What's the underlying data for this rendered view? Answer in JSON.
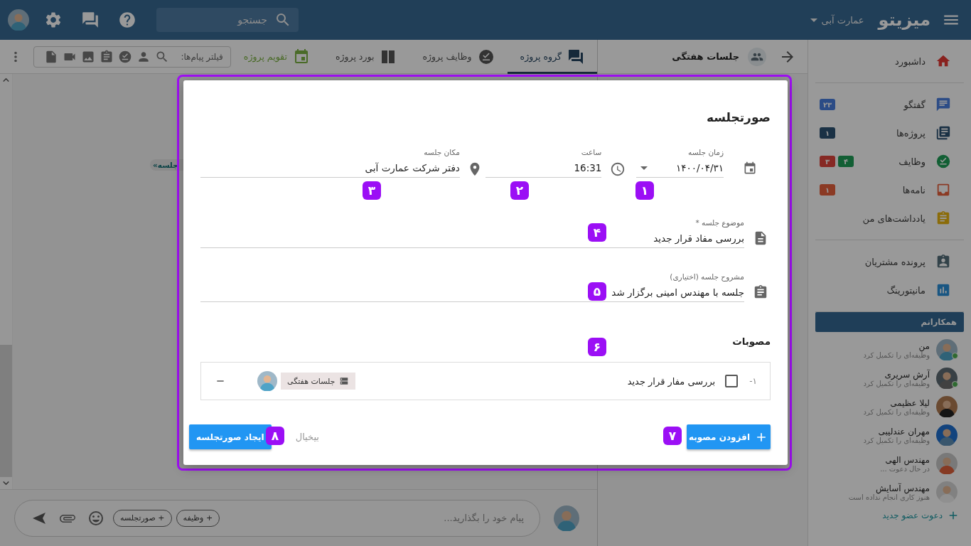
{
  "topbar": {
    "logo": "میزیتو",
    "workspace": "عمارت آبی",
    "search": {
      "placeholder": "جستجو"
    }
  },
  "sidebar": {
    "sections": [
      {
        "items": [
          {
            "label": "داشبورد",
            "color": "#89221f"
          }
        ]
      },
      {
        "items": [
          {
            "label": "گفتگو",
            "color": "#2c4c86",
            "badges": [
              {
                "text": "۲۳",
                "color": "#2c4c86"
              }
            ]
          },
          {
            "label": "پروژه‌ها",
            "color": "#1a3145",
            "badges": [
              {
                "text": "۱",
                "color": "#1a3145"
              }
            ]
          },
          {
            "label": "وظایف",
            "color": "#125f34",
            "badges": [
              {
                "text": "۴",
                "color": "#125f34"
              },
              {
                "text": "۳",
                "color": "#862924"
              }
            ]
          },
          {
            "label": "نامه‌ها",
            "color": "#8b3a24",
            "badges": [
              {
                "text": "۱",
                "color": "#8b3a24"
              }
            ]
          },
          {
            "label": "یادداشت‌های من",
            "color": "#8b6c09"
          }
        ]
      },
      {
        "items": [
          {
            "label": "پرونده مشتریان",
            "color": "#324249"
          },
          {
            "label": "مانیتورینگ",
            "color": "#195682"
          }
        ]
      }
    ],
    "colleagues": {
      "title": "همکارانم",
      "members": [
        {
          "name": "من",
          "status": "وظیفه‌ای را تکمیل کرد",
          "online": true
        },
        {
          "name": "آرش سریری",
          "status": "وظیفه‌ای را تکمیل کرد",
          "online": true
        },
        {
          "name": "لیلا عظیمی",
          "status": "وظیفه‌ای را تکمیل کرد",
          "online": false
        },
        {
          "name": "مهران عندلیبی",
          "status": "وظیفه‌ای را تکمیل کرد",
          "online": false
        },
        {
          "name": "مهندس الهی",
          "status": "در حال دعوت ...",
          "online": false
        },
        {
          "name": "مهندس آسایش",
          "status": "هنوز کاری انجام نداده است",
          "online": false
        }
      ],
      "invite": "دعوت عضو جدید"
    }
  },
  "channel_panel": {
    "title": "جلسات هفتگی"
  },
  "chat": {
    "tabs": [
      {
        "label": "گروه پروژه",
        "selected": true,
        "color": "#16293a"
      },
      {
        "label": "وظایف پروژه",
        "selected": false,
        "color": "#333333"
      },
      {
        "label": "بورد پروژه",
        "selected": false,
        "color": "#333333"
      },
      {
        "label": "تقویم پروژه",
        "selected": false,
        "color": "#4a6b28"
      }
    ],
    "filter_label": "فیلتر پیام‌ها:",
    "message_chip": "جلسه»",
    "composer": {
      "placeholder": "پیام خود را بگذارید...",
      "chips": [
        "+ وظیفه",
        "+ صورتجلسه"
      ]
    }
  },
  "dialog": {
    "title": "صورتجلسه",
    "date": {
      "label": "زمان جلسه",
      "value": "۱۴۰۰/۰۴/۳۱"
    },
    "time": {
      "label": "ساعت",
      "value": "16:31"
    },
    "place": {
      "label": "مکان جلسه",
      "value": "دفتر شرکت عمارت آبی"
    },
    "subject": {
      "label": "موضوع جلسه *",
      "value": "بررسی مفاد قرار جدید"
    },
    "details": {
      "label": "مشروح جلسه (اختیاری)",
      "value": "جلسه با مهندس امینی برگزار شد"
    },
    "approvals_title": "مصوبات",
    "approvals": [
      {
        "number": "۱-",
        "checked": false,
        "text": "بررسی مفار قرار جدید",
        "tag": "جلسات هفتگی"
      }
    ],
    "add_button": "افزودن مصوبه",
    "cancel": "بیخیال",
    "submit": "ایجاد صورتجلسه",
    "markers": [
      "۱",
      "۲",
      "۳",
      "۴",
      "۵",
      "۶",
      "۷",
      "۸"
    ]
  }
}
